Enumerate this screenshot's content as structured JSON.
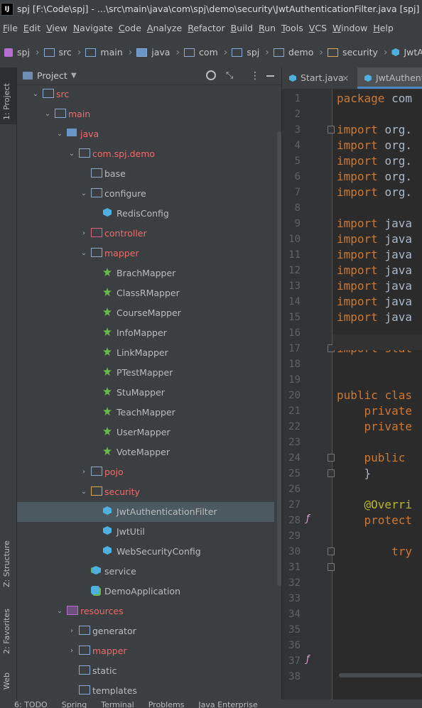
{
  "titlebar": {
    "logo": "IJ",
    "text": "spj [F:\\Code\\spj] - ...\\src\\main\\java\\com\\spj\\demo\\security\\JwtAuthenticationFilter.java [spj] - IntelliJ IDEA"
  },
  "menu": [
    "File",
    "Edit",
    "View",
    "Navigate",
    "Code",
    "Analyze",
    "Refactor",
    "Build",
    "Run",
    "Tools",
    "VCS",
    "Window",
    "Help"
  ],
  "breadcrumbs": [
    "spj",
    "src",
    "main",
    "java",
    "com",
    "spj",
    "demo",
    "security",
    "JwtAuthenticationFilter"
  ],
  "left_tabs": {
    "project": "1: Project",
    "structure": "Z: Structure",
    "favorites": "2: Favorites",
    "web": "Web"
  },
  "project_panel": {
    "title": "Project"
  },
  "tree": [
    {
      "label": "src",
      "depth": 0,
      "arrow": "open",
      "icon": "source-folder-icon",
      "red": true
    },
    {
      "label": "main",
      "depth": 1,
      "arrow": "open",
      "icon": "folder-icon",
      "red": true
    },
    {
      "label": "java",
      "depth": 2,
      "arrow": "open",
      "icon": "source-root-icon",
      "red": true
    },
    {
      "label": "com.spj.demo",
      "depth": 3,
      "arrow": "open",
      "icon": "package-icon",
      "red": true
    },
    {
      "label": "base",
      "depth": 4,
      "arrow": "none",
      "icon": "package-icon",
      "red": false
    },
    {
      "label": "configure",
      "depth": 4,
      "arrow": "open",
      "icon": "package-icon",
      "red": false
    },
    {
      "label": "RedisConfig",
      "depth": 5,
      "arrow": "none",
      "icon": "class-icon",
      "red": false
    },
    {
      "label": "controller",
      "depth": 4,
      "arrow": "closed",
      "icon": "package-gear-icon",
      "red": true
    },
    {
      "label": "mapper",
      "depth": 4,
      "arrow": "open",
      "icon": "package-icon",
      "red": true
    },
    {
      "label": "BrachMapper",
      "depth": 5,
      "arrow": "none",
      "icon": "mapper-icon",
      "red": false
    },
    {
      "label": "ClassRMapper",
      "depth": 5,
      "arrow": "none",
      "icon": "mapper-icon",
      "red": false
    },
    {
      "label": "CourseMapper",
      "depth": 5,
      "arrow": "none",
      "icon": "mapper-icon",
      "red": false
    },
    {
      "label": "InfoMapper",
      "depth": 5,
      "arrow": "none",
      "icon": "mapper-icon",
      "red": false
    },
    {
      "label": "LinkMapper",
      "depth": 5,
      "arrow": "none",
      "icon": "mapper-icon",
      "red": false
    },
    {
      "label": "PTestMapper",
      "depth": 5,
      "arrow": "none",
      "icon": "mapper-icon",
      "red": false
    },
    {
      "label": "StuMapper",
      "depth": 5,
      "arrow": "none",
      "icon": "mapper-icon",
      "red": false
    },
    {
      "label": "TeachMapper",
      "depth": 5,
      "arrow": "none",
      "icon": "mapper-icon",
      "red": false
    },
    {
      "label": "UserMapper",
      "depth": 5,
      "arrow": "none",
      "icon": "mapper-icon",
      "red": false
    },
    {
      "label": "VoteMapper",
      "depth": 5,
      "arrow": "none",
      "icon": "mapper-icon",
      "red": false
    },
    {
      "label": "pojo",
      "depth": 4,
      "arrow": "closed",
      "icon": "package-icon",
      "red": true
    },
    {
      "label": "security",
      "depth": 4,
      "arrow": "open",
      "icon": "package-lock-icon",
      "red": true
    },
    {
      "label": "JwtAuthenticationFilter",
      "depth": 5,
      "arrow": "none",
      "icon": "class-icon",
      "red": false,
      "selected": true
    },
    {
      "label": "JwtUtil",
      "depth": 5,
      "arrow": "none",
      "icon": "class-icon",
      "red": false
    },
    {
      "label": "WebSecurityConfig",
      "depth": 5,
      "arrow": "none",
      "icon": "class-icon",
      "red": false
    },
    {
      "label": "service",
      "depth": 4,
      "arrow": "none",
      "icon": "service-icon",
      "red": false
    },
    {
      "label": "DemoApplication",
      "depth": 4,
      "arrow": "none",
      "icon": "spring-app-icon",
      "red": false
    },
    {
      "label": "resources",
      "depth": 2,
      "arrow": "open",
      "icon": "resources-folder-icon",
      "red": true
    },
    {
      "label": "generator",
      "depth": 3,
      "arrow": "closed",
      "icon": "folder-icon",
      "red": false
    },
    {
      "label": "mapper",
      "depth": 3,
      "arrow": "closed",
      "icon": "folder-icon",
      "red": true
    },
    {
      "label": "static",
      "depth": 3,
      "arrow": "none",
      "icon": "folder-icon",
      "red": false
    },
    {
      "label": "templates",
      "depth": 3,
      "arrow": "none",
      "icon": "folder-icon",
      "red": false
    }
  ],
  "editor_tabs": [
    {
      "label": "Start.java",
      "close": "×",
      "active": false
    },
    {
      "label": "JwtAuthenticationFilter.java",
      "active": true
    }
  ],
  "code_lines": [
    {
      "n": "1",
      "t": [
        [
          "kw",
          "package "
        ],
        [
          "",
          "com"
        ]
      ]
    },
    {
      "n": "2",
      "t": []
    },
    {
      "n": "3",
      "t": [
        [
          "kw",
          "import "
        ],
        [
          "",
          "org."
        ]
      ]
    },
    {
      "n": "4",
      "t": [
        [
          "kw",
          "import "
        ],
        [
          "",
          "org."
        ]
      ]
    },
    {
      "n": "5",
      "t": [
        [
          "kw",
          "import "
        ],
        [
          "",
          "org."
        ]
      ]
    },
    {
      "n": "6",
      "t": [
        [
          "kw",
          "import "
        ],
        [
          "",
          "org."
        ]
      ]
    },
    {
      "n": "7",
      "t": [
        [
          "kw",
          "import "
        ],
        [
          "",
          "org."
        ]
      ]
    },
    {
      "n": "8",
      "t": []
    },
    {
      "n": "9",
      "t": [
        [
          "kw",
          "import "
        ],
        [
          "",
          "java"
        ]
      ]
    },
    {
      "n": "10",
      "t": [
        [
          "kw",
          "import "
        ],
        [
          "",
          "java"
        ]
      ]
    },
    {
      "n": "11",
      "t": [
        [
          "kw",
          "import "
        ],
        [
          "",
          "java"
        ]
      ]
    },
    {
      "n": "12",
      "t": [
        [
          "kw",
          "import "
        ],
        [
          "",
          "java"
        ]
      ]
    },
    {
      "n": "13",
      "t": [
        [
          "kw",
          "import "
        ],
        [
          "",
          "java"
        ]
      ]
    },
    {
      "n": "14",
      "t": [
        [
          "kw",
          "import "
        ],
        [
          "",
          "java"
        ]
      ]
    },
    {
      "n": "15",
      "t": [
        [
          "kw",
          "import "
        ],
        [
          "",
          "java"
        ]
      ]
    },
    {
      "n": "16",
      "t": []
    },
    {
      "n": "17",
      "t": [
        [
          "kw",
          "import "
        ],
        [
          "kw",
          "stat"
        ]
      ]
    },
    {
      "n": "18",
      "t": []
    },
    {
      "n": "19",
      "t": []
    },
    {
      "n": "20",
      "t": [
        [
          "kw",
          "public "
        ],
        [
          "kw",
          "clas"
        ]
      ]
    },
    {
      "n": "21",
      "t": [
        [
          "",
          "    "
        ],
        [
          "kw",
          "private"
        ]
      ]
    },
    {
      "n": "22",
      "t": [
        [
          "",
          "    "
        ],
        [
          "kw",
          "private"
        ]
      ]
    },
    {
      "n": "23",
      "t": []
    },
    {
      "n": "24",
      "t": [
        [
          "",
          "    "
        ],
        [
          "kw",
          "public "
        ]
      ]
    },
    {
      "n": "25",
      "t": [
        [
          "",
          "    }"
        ]
      ]
    },
    {
      "n": "26",
      "t": []
    },
    {
      "n": "27",
      "t": [
        [
          "",
          "    "
        ],
        [
          "ann",
          "@Overri"
        ]
      ]
    },
    {
      "n": "28",
      "t": [
        [
          "",
          "    "
        ],
        [
          "kw",
          "protect"
        ]
      ]
    },
    {
      "n": "29",
      "t": []
    },
    {
      "n": "30",
      "t": [
        [
          "",
          "        "
        ],
        [
          "kw",
          "try"
        ]
      ]
    },
    {
      "n": "31",
      "t": []
    },
    {
      "n": "32",
      "t": []
    },
    {
      "n": "33",
      "t": []
    },
    {
      "n": "34",
      "t": []
    },
    {
      "n": "35",
      "t": []
    },
    {
      "n": "36",
      "t": []
    },
    {
      "n": "37",
      "t": []
    },
    {
      "n": "38",
      "t": []
    }
  ],
  "bottom_tabs": [
    "6: TODO",
    "Spring",
    "Terminal",
    "Problems",
    "Java Enterprise"
  ]
}
